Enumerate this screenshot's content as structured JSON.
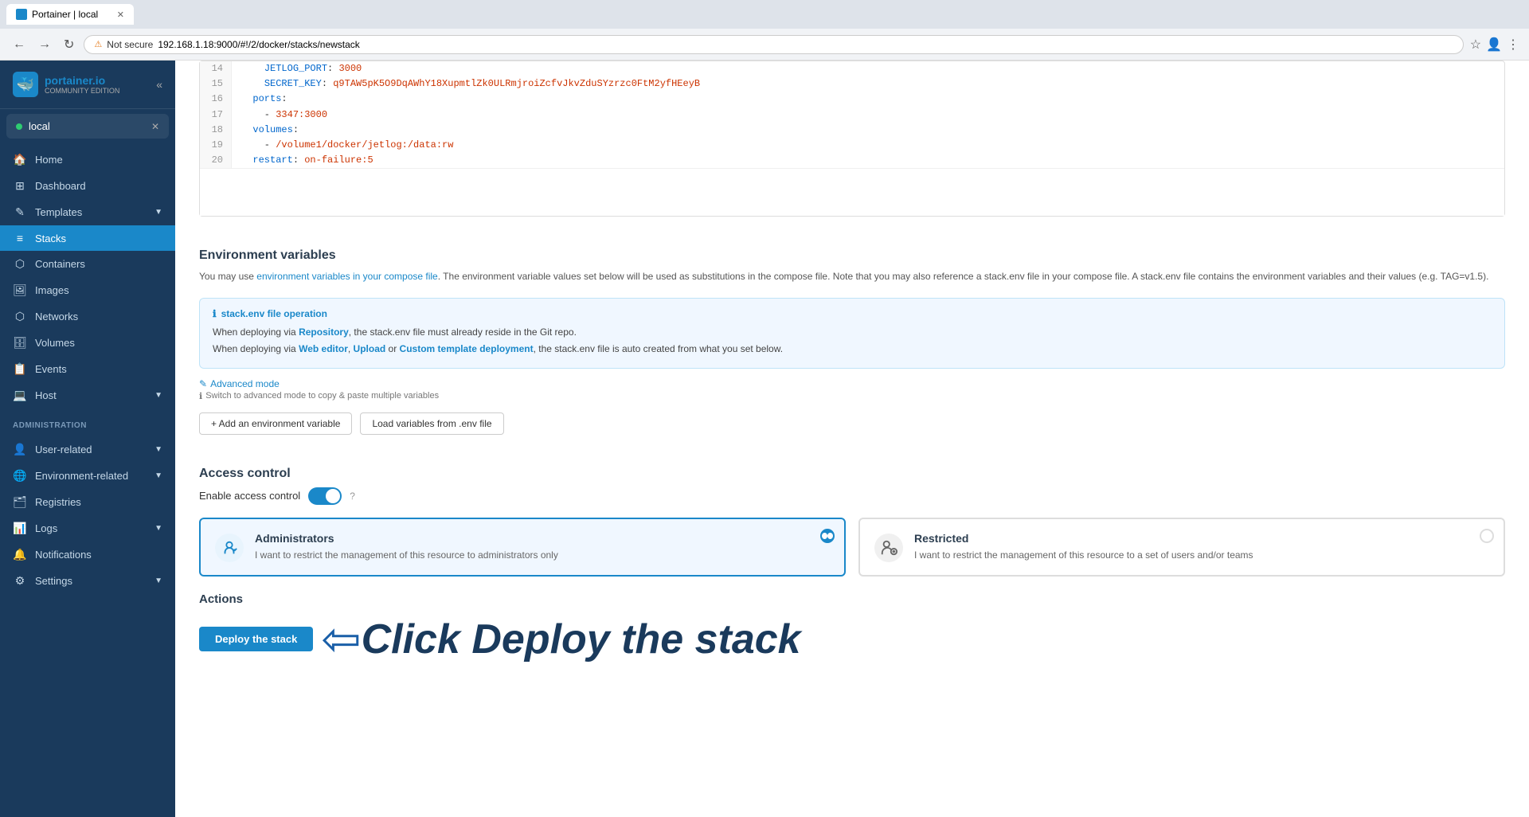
{
  "browser": {
    "tab_title": "Portainer | local",
    "address": "192.168.1.18:9000/#!/2/docker/stacks/newstack",
    "security_label": "Not secure"
  },
  "sidebar": {
    "logo_brand": "portainer.io",
    "logo_edition": "Community Edition",
    "endpoint": {
      "name": "local",
      "status": "connected"
    },
    "nav_items": [
      {
        "id": "home",
        "label": "Home",
        "icon": "🏠"
      },
      {
        "id": "dashboard",
        "label": "Dashboard",
        "icon": "⊞"
      },
      {
        "id": "templates",
        "label": "Templates",
        "icon": "✎",
        "has_arrow": true
      },
      {
        "id": "stacks",
        "label": "Stacks",
        "icon": "≡",
        "active": true
      },
      {
        "id": "containers",
        "label": "Containers",
        "icon": "⬡"
      },
      {
        "id": "images",
        "label": "Images",
        "icon": "🖼"
      },
      {
        "id": "networks",
        "label": "Networks",
        "icon": "⬡"
      },
      {
        "id": "volumes",
        "label": "Volumes",
        "icon": "🗄"
      },
      {
        "id": "events",
        "label": "Events",
        "icon": "📋"
      },
      {
        "id": "host",
        "label": "Host",
        "icon": "💻",
        "has_arrow": true
      }
    ],
    "admin_label": "Administration",
    "admin_items": [
      {
        "id": "user-related",
        "label": "User-related",
        "icon": "👤",
        "has_arrow": true
      },
      {
        "id": "environment-related",
        "label": "Environment-related",
        "icon": "🌐",
        "has_arrow": true
      },
      {
        "id": "registries",
        "label": "Registries",
        "icon": "🗂"
      },
      {
        "id": "logs",
        "label": "Logs",
        "icon": "📊",
        "has_arrow": true
      },
      {
        "id": "notifications",
        "label": "Notifications",
        "icon": "🔔"
      },
      {
        "id": "settings",
        "label": "Settings",
        "icon": "⚙",
        "has_arrow": true
      }
    ]
  },
  "code_editor": {
    "lines": [
      {
        "num": "14",
        "content": "    JETLOG_PORT: 3000"
      },
      {
        "num": "15",
        "content": "    SECRET_KEY: q9TAW5pK5O9DqAWhY18XupmtlZk0ULRmjroiZcfvJkvZduSYzrzc0FtM2yfHEeyB"
      },
      {
        "num": "16",
        "content": "  ports:"
      },
      {
        "num": "17",
        "content": "    - 3347:3000"
      },
      {
        "num": "18",
        "content": "  volumes:"
      },
      {
        "num": "19",
        "content": "    - /volume1/docker/jetlog:/data:rw"
      },
      {
        "num": "20",
        "content": "  restart: on-failure:5"
      }
    ]
  },
  "env_variables": {
    "section_title": "Environment variables",
    "section_desc_1": "You may use ",
    "section_desc_link": "environment variables in your compose file",
    "section_desc_2": ". The environment variable values set below will be used as substitutions in the compose file. Note that you may also reference a stack.env file in your compose file. A stack.env file contains the environment variables and their values (e.g. TAG=v1.5).",
    "info_title": "stack.env file operation",
    "info_line1_prefix": "When deploying via ",
    "info_line1_link1": "Repository",
    "info_line1_suffix": ", the stack.env file must already reside in the Git repo.",
    "info_line2_prefix": "When deploying via ",
    "info_line2_link1": "Web editor",
    "info_line2_sep1": ", ",
    "info_line2_link2": "Upload",
    "info_line2_sep2": " or ",
    "info_line2_link3": "Custom template deployment",
    "info_line2_suffix": ", the stack.env file is auto created from what you set below.",
    "advanced_mode_label": "Advanced mode",
    "advanced_mode_hint": "Switch to advanced mode to copy & paste multiple variables",
    "add_env_btn": "+ Add an environment variable",
    "load_env_btn": "Load variables from .env file"
  },
  "access_control": {
    "section_title": "Access control",
    "enable_label": "Enable access control",
    "enabled": true,
    "cards": [
      {
        "id": "administrators",
        "title": "Administrators",
        "desc": "I want to restrict the management of this resource to administrators only",
        "selected": true,
        "icon": "🔒"
      },
      {
        "id": "restricted",
        "title": "Restricted",
        "desc": "I want to restrict the management of this resource to a set of users and/or teams",
        "selected": false,
        "icon": "👥"
      }
    ]
  },
  "actions": {
    "label": "Actions",
    "deploy_btn": "Deploy the stack",
    "annotation_text": "Click Deploy the stack"
  }
}
